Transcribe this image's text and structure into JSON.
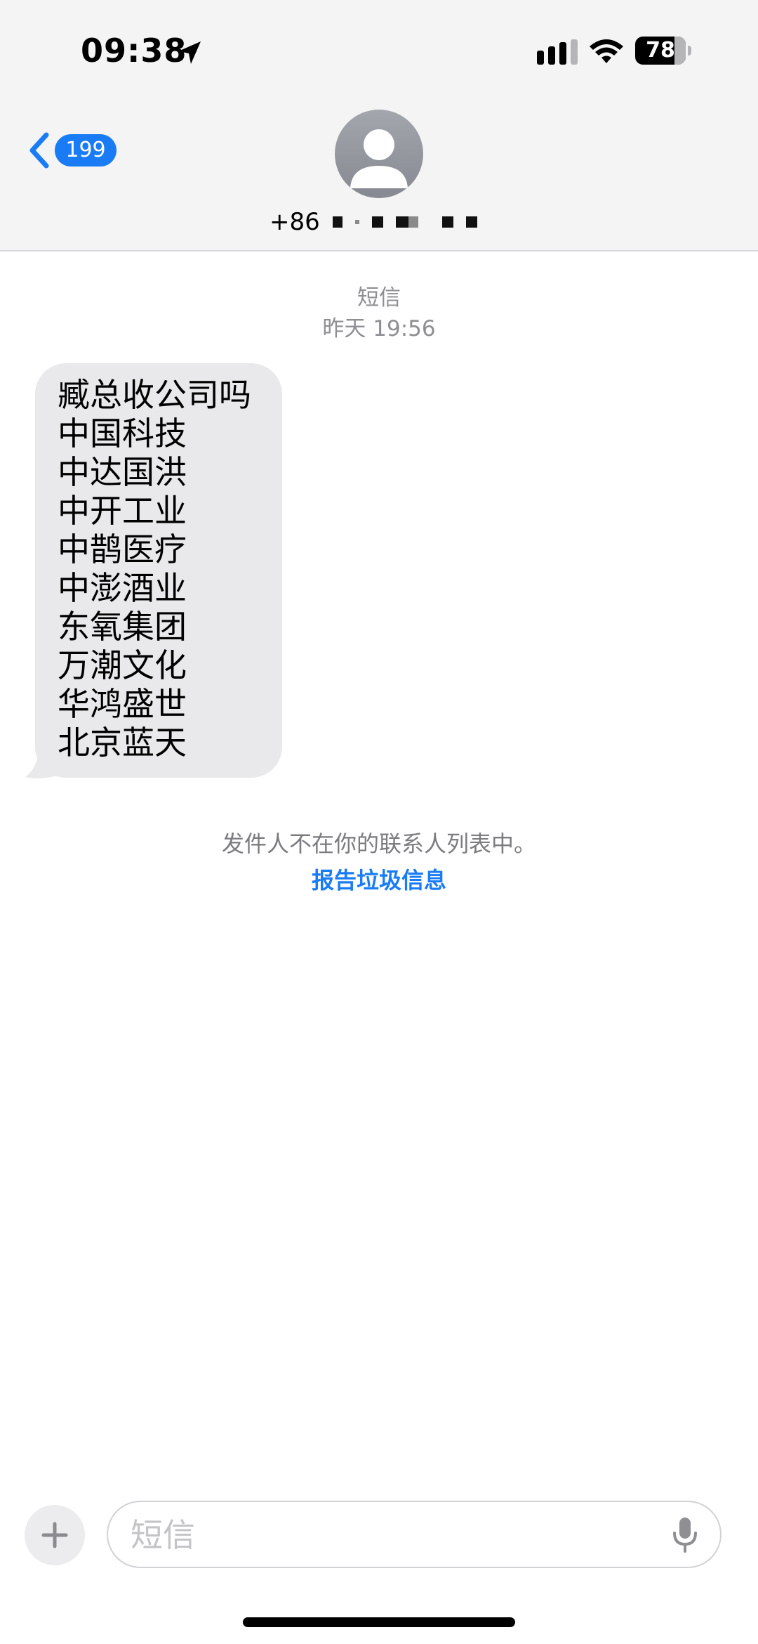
{
  "status_bar": {
    "time": "09:38",
    "battery_level": "78",
    "battery_fraction": 0.78,
    "icons": [
      "location-arrow-icon",
      "cellular-signal-icon",
      "wifi-icon",
      "battery-icon"
    ]
  },
  "nav": {
    "back_badge": "199",
    "back_icon": "chevron-left-icon",
    "avatar_icon": "person-silhouette-icon",
    "contact_number_visible": "+86"
  },
  "conversation": {
    "message_type": "短信",
    "timestamp": "昨天 19:56",
    "messages": [
      {
        "direction": "incoming",
        "lines": [
          "臧总收公司吗",
          "中国科技",
          "中达国洪",
          "中开工业",
          "中鹊医疗",
          "中澎酒业",
          "东氧集团",
          "万潮文化",
          "华鸿盛世",
          "北京蓝天"
        ]
      }
    ],
    "unknown_sender_notice": "发件人不在你的联系人列表中。",
    "report_junk_label": "报告垃圾信息"
  },
  "composer": {
    "placeholder": "短信",
    "value": "",
    "add_icon": "plus-icon",
    "mic_icon": "microphone-icon"
  },
  "colors": {
    "accent": "#1a7cf5",
    "header_bg": "#f4f4f5",
    "incoming_bubble": "#e9e9eb",
    "meta_text": "#8e8e93"
  }
}
